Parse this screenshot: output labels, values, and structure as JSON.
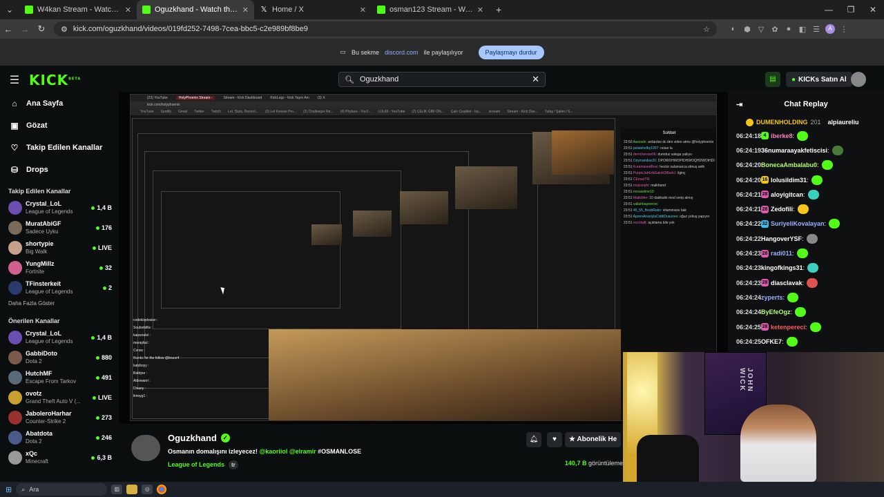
{
  "tabs": [
    {
      "label": "W4kan Stream - Watch Live on K",
      "icon": "kick",
      "active": false
    },
    {
      "label": "Oguzkhand - Watch the VOD",
      "icon": "kick",
      "active": true
    },
    {
      "label": "Home / X",
      "icon": "x",
      "active": false
    },
    {
      "label": "osman123 Stream - Watch Live",
      "icon": "kick",
      "active": false
    }
  ],
  "url": "kick.com/oguzkhand/videos/019fd252-7498-7cea-bbc5-c2e989bf8be9",
  "share": {
    "text1": "Bu sekme",
    "site": "discord.com",
    "text2": "ile paylaşılıyor",
    "button": "Paylaşmayı durdur"
  },
  "header": {
    "logo": "KICK",
    "logo_sup": "BETA",
    "search_value": "Oguzkhand",
    "kicks_button": "KICKs Satın Al"
  },
  "nav": [
    {
      "label": "Ana Sayfa",
      "icon": "home-icon",
      "glyph": "⌂"
    },
    {
      "label": "Gözat",
      "icon": "browse-icon",
      "glyph": "▣"
    },
    {
      "label": "Takip Edilen Kanallar",
      "icon": "heart-icon",
      "glyph": "♡"
    },
    {
      "label": "Drops",
      "icon": "drops-icon",
      "glyph": "⛁"
    }
  ],
  "followed_title": "Takip Edilen Kanallar",
  "followed": [
    {
      "name": "Crystal_LoL",
      "category": "League of Legends",
      "viewers": "1,4 B",
      "color": "#6a4fb0"
    },
    {
      "name": "MuratAbiGF",
      "category": "Sadece Uyku",
      "viewers": "176",
      "color": "#7a6a5a"
    },
    {
      "name": "shortypie",
      "category": "Big Walk",
      "viewers": "LIVE",
      "color": "#c6a08a"
    },
    {
      "name": "YungMillz",
      "category": "Fortnite",
      "viewers": "32",
      "color": "#d06090"
    },
    {
      "name": "TFinsterkeit",
      "category": "League of Legends",
      "viewers": "2",
      "color": "#2a3a6a"
    }
  ],
  "show_more": "Daha Fazla Göster",
  "recommended_title": "Önerilen Kanallar",
  "recommended": [
    {
      "name": "Crystal_LoL",
      "category": "League of Legends",
      "viewers": "1,4 B",
      "color": "#6a4fb0"
    },
    {
      "name": "GabbiDoto",
      "category": "Dota 2",
      "viewers": "880",
      "color": "#7a5a4a"
    },
    {
      "name": "HutchMF",
      "category": "Escape From Tarkov",
      "viewers": "491",
      "color": "#5a6a7a"
    },
    {
      "name": "ovotz",
      "category": "Grand Theft Auto V (...",
      "viewers": "LIVE",
      "color": "#c8a030"
    },
    {
      "name": "JaboleroHarhar",
      "category": "Counter-Strike 2",
      "viewers": "273",
      "color": "#9a3030"
    },
    {
      "name": "Abatdota",
      "category": "Dota 2",
      "viewers": "246",
      "color": "#4a5a8a"
    },
    {
      "name": "xQc",
      "category": "Minecraft",
      "viewers": "6,3 B",
      "color": "#999999"
    }
  ],
  "stream": {
    "name": "Oguzkhand",
    "title_plain": "Osmanın domalışını izleyecez! ",
    "title_mentions": "@kaoriiol @elramir",
    "title_tag": " #OSMANLOSE",
    "category": "League of Legends",
    "lang": "tr",
    "views_count": "140,7 B",
    "views_label": " görüntüleme",
    "subscribe": "Abonelik He"
  },
  "chat": {
    "title": "Chat Replay",
    "pinned_name": "DUMENHOLDING",
    "pinned_count": "201",
    "pinned_user2": "alpiaureliu",
    "messages": [
      {
        "time": "06:24:18",
        "badge": "4",
        "badge_color": "#53fc18",
        "user": "iberke8",
        "color": "#ff7ec0",
        "emote": "#53fc18"
      },
      {
        "time": "06:24:19",
        "badge": "",
        "badge_color": "",
        "user": "36numaraayakfetiscisi",
        "color": "#ffffff",
        "emote": "#4a7a3a"
      },
      {
        "time": "06:24:20",
        "badge": "",
        "badge_color": "",
        "user": "BonecaAmbalabu0",
        "color": "#b5ff6a",
        "emote": "#53fc18"
      },
      {
        "time": "06:24:20",
        "badge": "16",
        "badge_color": "#f5c518",
        "user": "lolusildim31",
        "color": "#ffffff",
        "emote": "#53fc18"
      },
      {
        "time": "06:24:21",
        "badge": "28",
        "badge_color": "#e05ab0",
        "user": "aloyigitcan",
        "color": "#ffffff",
        "emote": "#3ad0c0"
      },
      {
        "time": "06:24:21",
        "badge": "28",
        "badge_color": "#e05ab0",
        "user": "Zedofili",
        "color": "#ffffff",
        "emote": "#f5c518"
      },
      {
        "time": "06:24:22",
        "badge": "32",
        "badge_color": "#3ac0f0",
        "user": "SuriyeliKovalayan",
        "color": "#9ab0ff",
        "emote": "#53fc18"
      },
      {
        "time": "06:24:22",
        "badge": "",
        "badge_color": "",
        "user": "HangoverYSF",
        "color": "#ffffff",
        "emote": "#888888"
      },
      {
        "time": "06:24:23",
        "badge": "28",
        "badge_color": "#e05ab0",
        "user": "radi011",
        "color": "#9ab0ff",
        "emote": "#53fc18"
      },
      {
        "time": "06:24:23",
        "badge": "",
        "badge_color": "",
        "user": "kingofkings31",
        "color": "#ffffff",
        "emote": "#3ad0c0"
      },
      {
        "time": "06:24:23",
        "badge": "28",
        "badge_color": "#e05ab0",
        "user": "diasclavak",
        "color": "#ffffff",
        "emote": "#e05050"
      },
      {
        "time": "06:24:24",
        "badge": "",
        "badge_color": "",
        "user": "zyperts",
        "color": "#9ab0ff",
        "emote": "#53fc18"
      },
      {
        "time": "06:24:24",
        "badge": "",
        "badge_color": "",
        "user": "ByEfeOgz",
        "color": "#b5ff6a",
        "emote": "#53fc18"
      },
      {
        "time": "06:24:25",
        "badge": "28",
        "badge_color": "#e05ab0",
        "user": "ketenpereci",
        "color": "#ff5a5a",
        "emote": "#53fc18"
      },
      {
        "time": "06:24:25",
        "badge": "",
        "badge_color": "",
        "user": "OFKE7",
        "color": "#ffffff",
        "emote": "#53fc18"
      }
    ]
  },
  "inner_stream": {
    "tabs": [
      "(23) YouTube",
      "HolyPhoenix Stream -",
      "Stream - Kick Dashboard",
      "KickLogz - Kick Yayın Anı",
      "(3) X"
    ],
    "bookmarks": [
      "YouTube",
      "Spotify",
      "Gmail",
      "Twitter",
      "Twitch",
      "LoL Stats, Record...",
      "(2) Lol Korean Pro...",
      "(2) Challenger Re...",
      "(4) Phylans - YouT...",
      "LOL66 - YouTube",
      "(2) ÇELİK GİBİ ÖN...",
      "Çakı Çeşitleri - bıç...",
      "scream",
      "Stream - Kick Das...",
      "Tufaş / Şahin / S..."
    ],
    "url": "kick.com/holyphoenix",
    "chat_title": "Sohbet",
    "chat_lines": [
      {
        "t": "23:50",
        "u": "Awsoule:",
        "m": "ardardav dc den video atms @holyphoenix",
        "c": "g"
      },
      {
        "t": "23:51",
        "u": "polatshelby1907:",
        "m": "nolue la",
        "c": "c"
      },
      {
        "t": "23:51",
        "u": "derricksrose06:",
        "m": "dumduz salaga yallıyo",
        "c": "pk"
      },
      {
        "t": "23:51",
        "u": "Ozymandias31:",
        "m": "DPOWUHWOPIDHWOQHDWOIHDIOOWHDI",
        "c": "c"
      },
      {
        "t": "23:51",
        "u": "KuramasedRosi:",
        "m": "hector salamanca olmuş anlk",
        "c": "pk"
      },
      {
        "t": "23:51",
        "u": "PurpleJahErikSakinOlBarkJ:",
        "m": "ilginç",
        "c": "pk"
      },
      {
        "t": "23:51",
        "u": "CEmaxTR:",
        "m": "",
        "c": "pk"
      },
      {
        "t": "23:51",
        "u": "mxjosephi:",
        "m": "malkhand",
        "c": "pk"
      },
      {
        "t": "23:51",
        "u": "novaseline10:",
        "m": "",
        "c": "g"
      },
      {
        "t": "23:51",
        "u": "MatisMer:",
        "m": "10 dakikalık mod verip almış",
        "c": "pk"
      },
      {
        "t": "23:51",
        "u": "vallahbaşmerve:",
        "m": "",
        "c": "g"
      },
      {
        "t": "23:51",
        "u": "45_55_BoobRatio:",
        "m": "vitaminsize bak",
        "c": "c"
      },
      {
        "t": "23:51",
        "u": "AponnAnasiylaCiddiDusunen:",
        "m": "oğuz yokuş yapıyor",
        "c": "c"
      },
      {
        "t": "23:51",
        "u": "vizorkaft:",
        "m": "açıklama bile yok",
        "c": "pk"
      }
    ],
    "overlay_lines": [
      "codekixplosion :",
      "Soulsebillis :",
      "kaizenelel :",
      "maraybul :",
      "Cvrsw :",
      "thanks for the follow @bruce4",
      "katzboyy :",
      "Battrjoe :",
      "Aldowanri :",
      "Disany :",
      "limoyg1 :"
    ]
  }
}
